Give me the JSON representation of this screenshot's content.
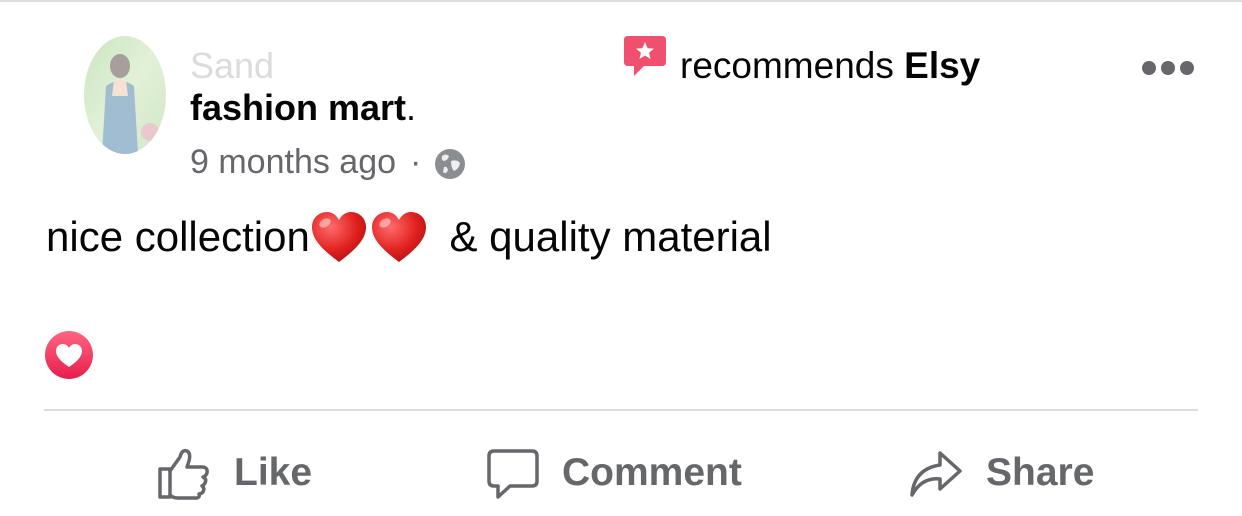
{
  "post": {
    "author_faded": "Sand",
    "page_name": "fashion mart",
    "page_name_suffix": ".",
    "timestamp": "9 months ago",
    "separator": "·",
    "privacy_icon": "globe-icon",
    "recommends_prefix": "recommends",
    "recommended_page": "Elsy",
    "recommend_icon": "recommend-star-icon",
    "more_icon": "more-options-icon",
    "text_before": "nice collection",
    "text_after": " & quality material",
    "emoji": [
      "heart-emoji",
      "heart-emoji"
    ],
    "reaction_icon": "love-reaction-icon"
  },
  "actions": {
    "like_label": "Like",
    "comment_label": "Comment",
    "share_label": "Share"
  },
  "colors": {
    "recommend_accent": "#f0506e",
    "reaction_red": "#f33e58",
    "secondary_text": "#65676b",
    "divider": "#dadde1"
  }
}
